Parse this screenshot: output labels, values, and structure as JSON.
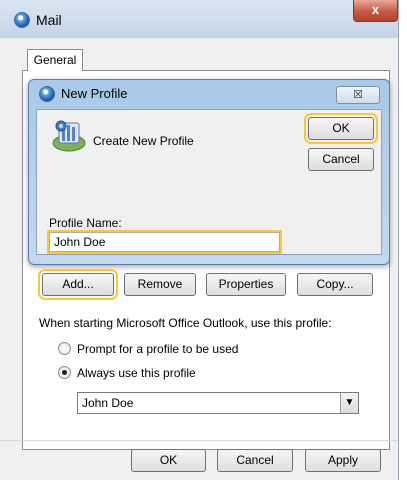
{
  "window": {
    "title": "Mail",
    "close_glyph": "x"
  },
  "tabs": [
    {
      "label": "General",
      "selected": true
    }
  ],
  "new_profile_dialog": {
    "title": "New Profile",
    "close_glyph": "☒",
    "heading": "Create New Profile",
    "ok_label": "OK",
    "cancel_label": "Cancel",
    "profile_name_label": "Profile Name:",
    "profile_name_value": "John Doe"
  },
  "profile_buttons": {
    "add": "Add...",
    "remove": "Remove",
    "properties": "Properties",
    "copy": "Copy..."
  },
  "startup": {
    "label": "When starting Microsoft Office Outlook, use this profile:",
    "options": [
      {
        "label": "Prompt for a profile to be used",
        "selected": false
      },
      {
        "label": "Always use this profile",
        "selected": true
      }
    ],
    "profile_select_value": "John Doe",
    "dropdown_glyph": "▼"
  },
  "footer": {
    "ok": "OK",
    "cancel": "Cancel",
    "apply": "Apply"
  },
  "colors": {
    "focus_highlight": "#f7c93a",
    "dialog_frame": "#b8d0ea",
    "close_button": "#c75a44"
  }
}
